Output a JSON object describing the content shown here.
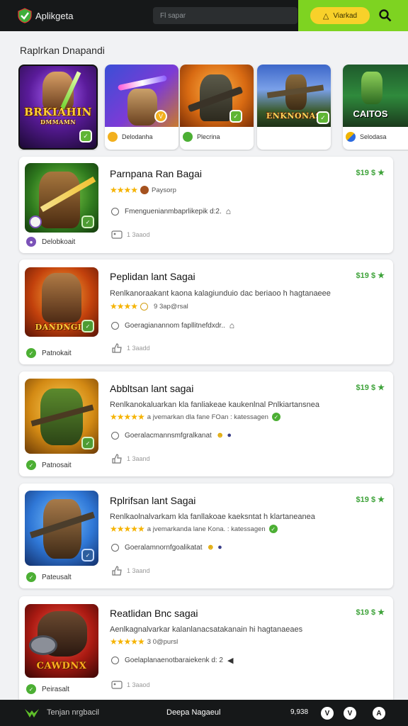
{
  "header": {
    "brand": "Aplikgeta",
    "search_placeholder": "Fl sapar",
    "verified_label": "Viarkad"
  },
  "featured": {
    "title": "Raplrkan Dnapandi",
    "items": [
      {
        "label": "",
        "art_text": "BRKIAHIN",
        "art_sub": "DMMAMN"
      },
      {
        "label": "Delodanha"
      },
      {
        "label": "Plecrina"
      },
      {
        "label": "",
        "art_text": "ENKNONAS"
      },
      {
        "label": "Selodasa",
        "art_text": "CAITOS"
      }
    ]
  },
  "apps": [
    {
      "title": "Parnpana Ran Bagai",
      "price": "$19 $ ★",
      "description": "",
      "rating_stars": "★★★★",
      "rating_text": "Paysorp",
      "sub": "Fmenguenianmbaprlikepik d:2.",
      "meta": "1 3aaod",
      "developer": "Delobkoait",
      "art_text": ""
    },
    {
      "title": "Peplidan lant Sagai",
      "price": "$19 $ ★",
      "description": "Renlkanoraakant kaona kalagiunduio dac beriaoo h hagtanaeee",
      "rating_stars": "★★★★",
      "rating_text": "9 3ap@rsal",
      "sub": "Goeragianannom fapllitnefdxdr..",
      "meta": "1 3aadd",
      "developer": "Patnokait",
      "art_text": "DANDNGIA"
    },
    {
      "title": "Abbltsan lant sagai",
      "price": "$19 $ ★",
      "description": "Renlkanokaluarkan kla fanliakeae kaukenlnal Pnlkiartansnea",
      "rating_stars": "★★★★★",
      "rating_text": "a jvemarkan dla fane FOan : katessagen",
      "sub": "Goeralacmannsmfgralkanat",
      "meta": "1 3aand",
      "developer": "Patnosait",
      "art_text": ""
    },
    {
      "title": "Rplrifsan lant Sagai",
      "price": "$19 $ ★",
      "description": "Renlkaolnalvarkam kla fanllakoae kaeksntat h klartaneanea",
      "rating_stars": "★★★★★",
      "rating_text": "a jvemarkanda lane Kona. : katessagen",
      "sub": "Goeralamnornfgoalikatat",
      "meta": "1 3aand",
      "developer": "Pateusalt",
      "art_text": ""
    },
    {
      "title": "Reatlidan Bnc sagai",
      "price": "$19 $ ★",
      "description": "Aenlkagnalvarkar kalanlanacsatakanain hi hagtanaeaes",
      "rating_stars": "★★★★★",
      "rating_text": "3 0@pursl",
      "sub": "Goelaplanaenotbaraiekenk d: 2",
      "meta": "1 3aaod",
      "developer": "Peirasalt",
      "art_text": "CAWDNX"
    }
  ],
  "bottom_bar": {
    "left_label": "Tenjan nrgbacil",
    "center_label": "Deepa Nagaeul",
    "count": "9,938",
    "buttons": [
      "V",
      "V",
      "A"
    ]
  },
  "colors": {
    "accent_green": "#7ed321",
    "price_green": "#3fa33b",
    "star_gold": "#f5b302",
    "verified_yellow": "#f8d12a",
    "header_dark": "#161819"
  }
}
